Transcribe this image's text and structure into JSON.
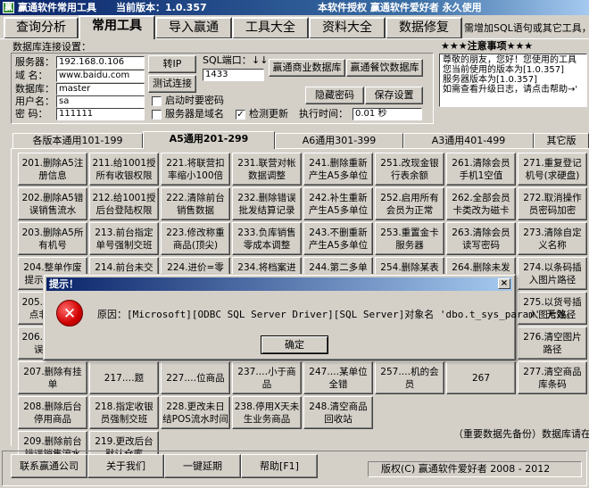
{
  "window": {
    "title": "赢通软件常用工具",
    "version": "当前版本：1.0.357",
    "right_text": "本软件授权  赢通软件爱好者  永久使用",
    "icon_glyph": "赢"
  },
  "main_tabs": [
    {
      "label": "查询分析"
    },
    {
      "label": "常用工具"
    },
    {
      "label": "导入赢通"
    },
    {
      "label": "工具大全"
    },
    {
      "label": "资料大全"
    },
    {
      "label": "数据修复"
    }
  ],
  "marquee": "需增加SQL语句或其它工具，",
  "db": {
    "group_title": "数据库连接设置：",
    "server_label": "服务器：",
    "server_value": "192.168.0.106",
    "domain_label": "域  名：",
    "domain_value": "www.baidu.com",
    "database_label": "数据库：",
    "database_value": "master",
    "user_label": "用户名：",
    "user_value": "sa",
    "password_label": "密  码：",
    "password_value": "111111",
    "convert_ip": "转IP",
    "test_connection": "测试连接",
    "sql_port_label": "SQL端口：",
    "sql_port_value": "1433",
    "arrows": "↓↓",
    "commercial_db": "赢通商业数据库",
    "catering_db": "赢通餐饮数据库",
    "hide_password": "隐藏密码",
    "save_settings": "保存设置",
    "remember_password": "启动时要密码",
    "server_is_domain": "服务器是域名",
    "check_update": "检测更新",
    "exec_time_label": "执行时间：",
    "exec_time_value": "0.01 秒"
  },
  "notes": {
    "title": "★★★注意事项★★★",
    "lines": [
      "尊敬的朋友，您好！您使用的工具",
      "您当前使用的版本为[1.0.357]",
      "服务器版本为[1.0.357]",
      "如需查看升级日志，请点击帮助→'"
    ]
  },
  "sub_tabs": [
    {
      "label": "各版本通用101-199"
    },
    {
      "label": "A5通用201-299"
    },
    {
      "label": "A6通用301-399"
    },
    {
      "label": "A3通用401-499"
    },
    {
      "label": "其它版"
    }
  ],
  "tools": [
    {
      "label": "201.删除A5注册信息"
    },
    {
      "label": "211.给1001授所有收银权限"
    },
    {
      "label": "221.将联营扣率缩小100倍"
    },
    {
      "label": "231.联营对帐数据调整"
    },
    {
      "label": "241.删除重新产生A5多单位"
    },
    {
      "label": "251.改现金银行表余额"
    },
    {
      "label": "261.清除会员手机1空值"
    },
    {
      "label": "271.重复登记机号(求硬盘)"
    },
    {
      "label": "202.删除A5错误销售流水"
    },
    {
      "label": "212.给1001授后台登陆权限"
    },
    {
      "label": "222.清除前台销售数据"
    },
    {
      "label": "232.删除错误批发结算记录"
    },
    {
      "label": "242.补生重新产生A5多单位"
    },
    {
      "label": "252.启用所有会员为正常"
    },
    {
      "label": "262.全部会员卡类改为磁卡"
    },
    {
      "label": "272.取消操作员密码加密"
    },
    {
      "label": "203.删除A5所有机号"
    },
    {
      "label": "213.前台指定单号强制交班"
    },
    {
      "label": "223.修改称重商品(顶尖)"
    },
    {
      "label": "233.负库销售零成本调整"
    },
    {
      "label": "243.不删重新产生A5多单位"
    },
    {
      "label": "253.重置金卡服务器"
    },
    {
      "label": "263.清除会员读写密码"
    },
    {
      "label": "273.清除自定义名称"
    },
    {
      "label": "204.整单作废提示重复插入"
    },
    {
      "label": "214.前台未交班全部交班"
    },
    {
      "label": "224.进价=零售价"
    },
    {
      "label": "234.将档案进价更新到期初"
    },
    {
      "label": "244.第二多单位改为默认值"
    },
    {
      "label": "254.删除某表的传输日志"
    },
    {
      "label": "264.删除未发行的会员"
    },
    {
      "label": "274.以条码插入图片路径"
    },
    {
      "label": "205.删除A5错点非销售的"
    },
    {
      "label": "215"
    },
    {
      "label": "225"
    },
    {
      "label": "235"
    },
    {
      "label": "245"
    },
    {
      "label": "255"
    },
    {
      "label": "265"
    },
    {
      "label": "275.以货号插入图片路径"
    },
    {
      "label": "206.删除A5错误当日…"
    },
    {
      "label": "216"
    },
    {
      "label": "226"
    },
    {
      "label": "236"
    },
    {
      "label": "246"
    },
    {
      "label": "256"
    },
    {
      "label": "266"
    },
    {
      "label": "276.清空图片路径"
    },
    {
      "label": "207.删除有挂单"
    },
    {
      "label": "217.…题"
    },
    {
      "label": "227.…位商品"
    },
    {
      "label": "237.…小于商品"
    },
    {
      "label": "247.…某单位全错"
    },
    {
      "label": "257.…机的会员"
    },
    {
      "label": "267"
    },
    {
      "label": "277.清空商品库条码"
    },
    {
      "label": "208.删除后台停用商品"
    },
    {
      "label": "218.指定收银员强制交班"
    },
    {
      "label": "228.更改未日结POS流水时间"
    },
    {
      "label": "238.停用X天未生业务商品"
    },
    {
      "label": "248.清空商品回收站"
    },
    {
      "label": "209.删除前台错误销售流水"
    },
    {
      "label": "219.更改后台默认仓库"
    }
  ],
  "hint": "（重要数据先备份）数据库请在",
  "bottom": {
    "contact": "联系赢通公司",
    "about": "关于我们",
    "extend": "一键延期",
    "help": "帮助[F1]",
    "copyright": "版权(C) 赢通软件爱好者 2008 - 2012"
  },
  "dialog": {
    "title": "提示！",
    "message": "原因：[Microsoft][ODBC SQL Server Driver][SQL Server]对象名 'dbo.t_sys_param' 无效。",
    "ok": "确定",
    "close_glyph": "×",
    "icon_glyph": "✕"
  },
  "colors": {
    "face": "#d4d0c8",
    "titlebar_start": "#0a246a",
    "titlebar_end": "#a6caf0",
    "error_red": "#d00000"
  }
}
